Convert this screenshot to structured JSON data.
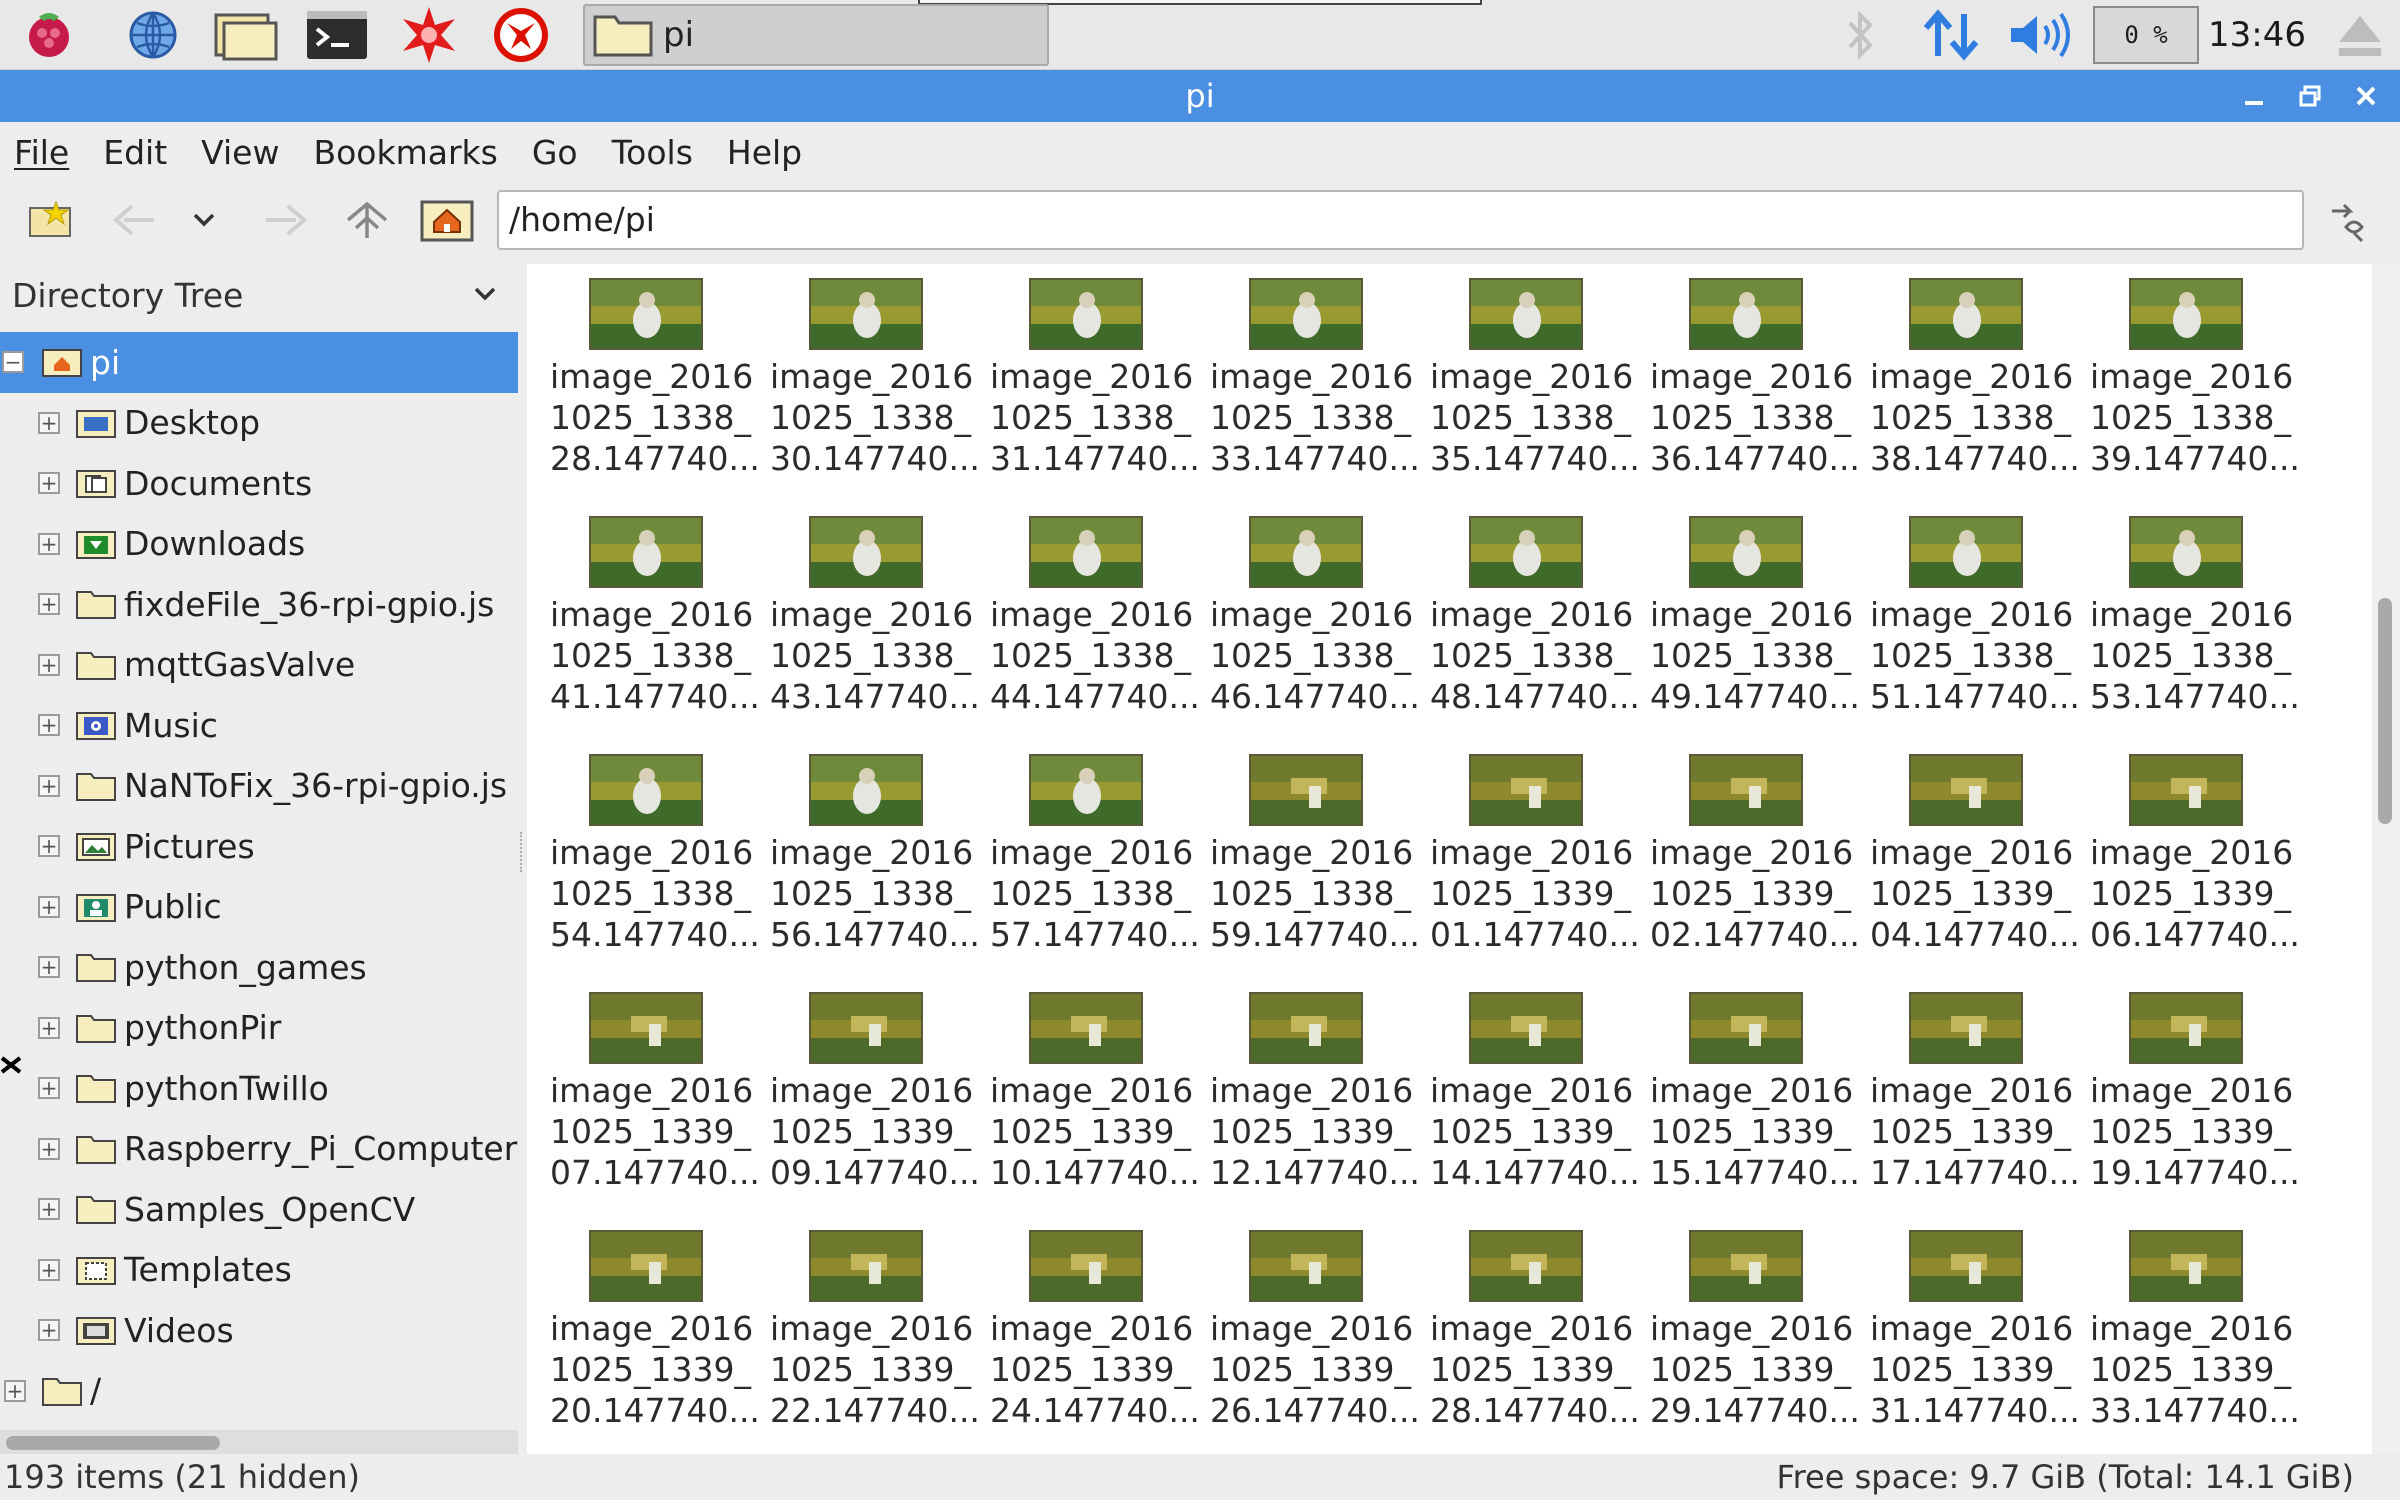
{
  "taskbar": {
    "task_label": "pi",
    "cpu_usage": "0 %",
    "clock": "13:46",
    "launchers": [
      "raspberry-menu-icon",
      "web-browser-icon",
      "file-manager-icon",
      "terminal-icon",
      "mathematica-icon",
      "wolfram-icon"
    ]
  },
  "window": {
    "title": "pi"
  },
  "menu": {
    "file": "File",
    "edit": "Edit",
    "view": "View",
    "bookmarks": "Bookmarks",
    "go": "Go",
    "tools": "Tools",
    "help": "Help"
  },
  "toolbar": {
    "location": "/home/pi"
  },
  "sidebar": {
    "header": "Directory Tree",
    "root": "pi",
    "items": [
      "Desktop",
      "Documents",
      "Downloads",
      "fixdeFile_36-rpi-gpio.js",
      "mqttGasValve",
      "Music",
      "NaNToFix_36-rpi-gpio.js",
      "Pictures",
      "Public",
      "python_games",
      "pythonPir",
      "pythonTwillo",
      "Raspberry_Pi_Computer",
      "Samples_OpenCV",
      "Templates",
      "Videos"
    ],
    "fs_root": "/"
  },
  "files": {
    "line1": "image_2016",
    "rows": [
      {
        "line2": [
          "1025_1338_",
          "1025_1338_",
          "1025_1338_",
          "1025_1338_",
          "1025_1338_",
          "1025_1338_",
          "1025_1338_",
          "1025_1338_"
        ],
        "line3": [
          "28.147740...",
          "30.147740...",
          "31.147740...",
          "33.147740...",
          "35.147740...",
          "36.147740...",
          "38.147740...",
          "39.147740..."
        ]
      },
      {
        "line2": [
          "1025_1338_",
          "1025_1338_",
          "1025_1338_",
          "1025_1338_",
          "1025_1338_",
          "1025_1338_",
          "1025_1338_",
          "1025_1338_"
        ],
        "line3": [
          "41.147740...",
          "43.147740...",
          "44.147740...",
          "46.147740...",
          "48.147740...",
          "49.147740...",
          "51.147740...",
          "53.147740..."
        ]
      },
      {
        "line2": [
          "1025_1338_",
          "1025_1338_",
          "1025_1338_",
          "1025_1338_",
          "1025_1339_",
          "1025_1339_",
          "1025_1339_",
          "1025_1339_"
        ],
        "line3": [
          "54.147740...",
          "56.147740...",
          "57.147740...",
          "59.147740...",
          "01.147740...",
          "02.147740...",
          "04.147740...",
          "06.147740..."
        ]
      },
      {
        "line2": [
          "1025_1339_",
          "1025_1339_",
          "1025_1339_",
          "1025_1339_",
          "1025_1339_",
          "1025_1339_",
          "1025_1339_",
          "1025_1339_"
        ],
        "line3": [
          "07.147740...",
          "09.147740...",
          "10.147740...",
          "12.147740...",
          "14.147740...",
          "15.147740...",
          "17.147740...",
          "19.147740..."
        ]
      },
      {
        "line2": [
          "1025_1339_",
          "1025_1339_",
          "1025_1339_",
          "1025_1339_",
          "1025_1339_",
          "1025_1339_",
          "1025_1339_",
          "1025_1339_"
        ],
        "line3": [
          "20.147740...",
          "22.147740...",
          "24.147740...",
          "26.147740...",
          "28.147740...",
          "29.147740...",
          "31.147740...",
          "33.147740..."
        ]
      }
    ]
  },
  "status": {
    "items": "193 items (21 hidden)",
    "free_space": "Free space: 9.7 GiB (Total: 14.1 GiB)"
  },
  "colors": {
    "accent": "#4b8fe3",
    "thumbnail_yellow": "#9a9a32",
    "thumbnail_green": "#3f6a2a"
  }
}
